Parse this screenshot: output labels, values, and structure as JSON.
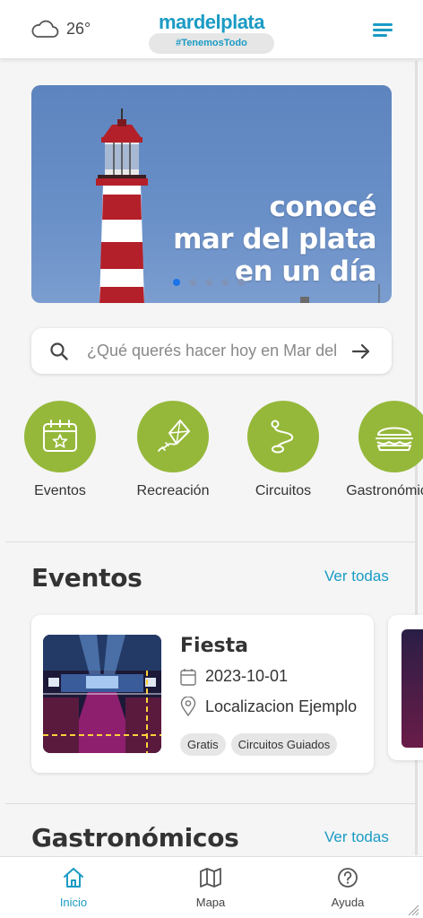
{
  "header": {
    "temperature": "26°",
    "weather_icon": "cloud-icon",
    "logo_name": "mardelplata",
    "logo_tagline": "#TenemosTodo",
    "menu_icon": "hamburger-menu-icon"
  },
  "hero": {
    "line1": "conocé",
    "line2": "mar del plata",
    "line3": "en un día",
    "slides": 5,
    "active_slide": 1
  },
  "search": {
    "placeholder": "¿Qué querés hacer hoy en Mar del Plata?",
    "search_icon": "search-icon",
    "submit_icon": "arrow-right-icon"
  },
  "categories": [
    {
      "label": "Eventos",
      "icon": "calendar-star-icon"
    },
    {
      "label": "Recreación",
      "icon": "kite-icon"
    },
    {
      "label": "Circuitos",
      "icon": "route-icon"
    },
    {
      "label": "Gastronómicos",
      "icon": "burger-icon"
    }
  ],
  "colors": {
    "brand": "#1a9bc4",
    "category": "#95b83a",
    "dot_active": "#1a73e8"
  },
  "events_section": {
    "title": "Eventos",
    "see_all": "Ver todas",
    "card": {
      "title": "Fiesta",
      "date": "2023-10-01",
      "location": "Localizacion Ejemplo",
      "tags": [
        "Gratis",
        "Circuitos Guiados"
      ]
    }
  },
  "gastro_section": {
    "title": "Gastronómicos",
    "see_all": "Ver todas"
  },
  "bottom_nav": [
    {
      "label": "Inicio",
      "icon": "home-icon",
      "active": true
    },
    {
      "label": "Mapa",
      "icon": "map-icon",
      "active": false
    },
    {
      "label": "Ayuda",
      "icon": "help-circle-icon",
      "active": false
    }
  ]
}
